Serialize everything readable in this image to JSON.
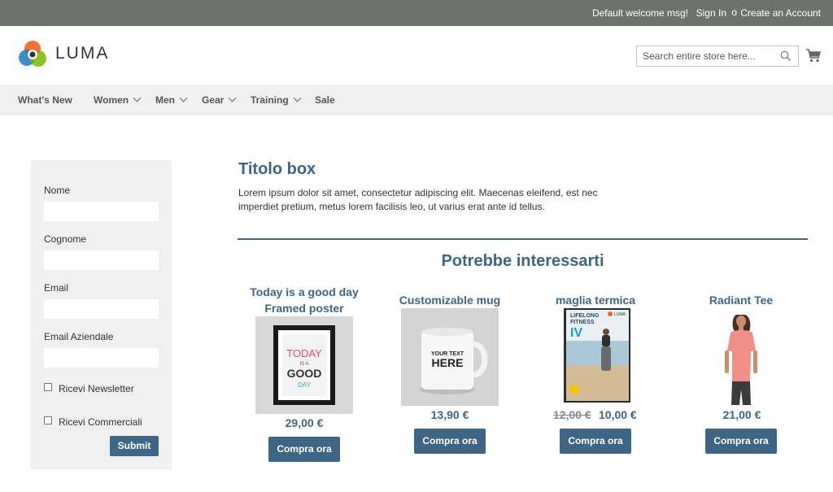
{
  "topbar": {
    "welcome": "Default welcome msg!",
    "signin": "Sign In",
    "separator": "o",
    "create_account": "Create an Account"
  },
  "header": {
    "logo_text": "LUMA",
    "search_placeholder": "Search entire store here...",
    "icons": [
      "search-icon",
      "cart-icon"
    ]
  },
  "nav": {
    "items": [
      {
        "label": "What's New"
      },
      {
        "label": "Women"
      },
      {
        "label": "Men"
      },
      {
        "label": "Gear"
      },
      {
        "label": "Training"
      },
      {
        "label": "Sale"
      }
    ]
  },
  "form": {
    "fields": [
      {
        "label": "Nome",
        "value": ""
      },
      {
        "label": "Cognome",
        "value": ""
      },
      {
        "label": "Email",
        "value": ""
      },
      {
        "label": "Email Aziendale",
        "value": ""
      }
    ],
    "checkboxes": [
      {
        "label": "Ricevi Newsletter",
        "checked": false
      },
      {
        "label": "Ricevi Commerciali",
        "checked": false
      }
    ],
    "submit": "Submit"
  },
  "content": {
    "title": "Titolo box",
    "text": "Lorem ipsum dolor sit amet, consectetur adipiscing elit. Maecenas eleifend, est nec imperdiet pretium, metus lorem facilisis leo, ut varius erat ante id tellus.",
    "section_title": "Potrebbe interessarti"
  },
  "products": [
    {
      "name_line1": "Today is a good day",
      "name_line2": "Framed poster",
      "price": "29,00 €",
      "buy": "Compra ora",
      "poster_text": [
        "TODAY",
        "IS A",
        "GOOD",
        "DAY"
      ]
    },
    {
      "name_line1": "Customizable mug",
      "price": "13,90 €",
      "buy": "Compra ora",
      "mug_text": [
        "YOUR TEXT",
        "HERE"
      ]
    },
    {
      "name_line1": "maglia termica",
      "old_price": "12,00 €",
      "price": "10,00 €",
      "buy": "Compra ora",
      "dvd_text": [
        "LIFELONG",
        "FITNESS",
        "IV"
      ],
      "dvd_brand": "LUMA"
    },
    {
      "name_line1": "Radiant Tee",
      "price": "21,00 €",
      "buy": "Compra ora"
    }
  ],
  "colors": {
    "accent": "#3f6584",
    "topbar": "#6e716e",
    "nav_bg": "#f0f0f0"
  }
}
